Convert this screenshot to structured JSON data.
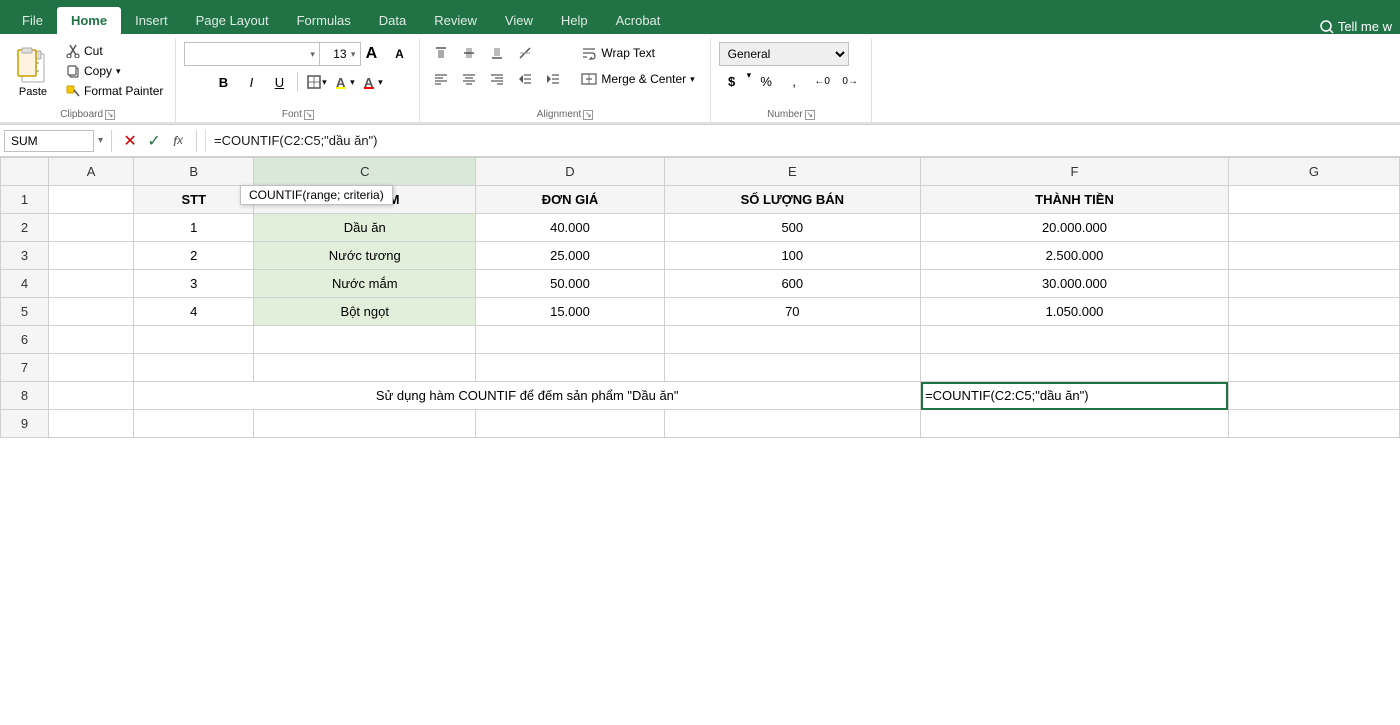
{
  "tabs": {
    "items": [
      "File",
      "Home",
      "Insert",
      "Page Layout",
      "Formulas",
      "Data",
      "Review",
      "View",
      "Help",
      "Acrobat"
    ],
    "active": "Home",
    "tell_me": "Tell me w"
  },
  "ribbon": {
    "groups": {
      "clipboard": {
        "label": "Clipboard",
        "paste_label": "Paste",
        "cut_label": "Cut",
        "copy_label": "Copy",
        "format_painter_label": "Format Painter"
      },
      "font": {
        "label": "Font",
        "font_name": "",
        "font_size": "13",
        "bold": "B",
        "italic": "I",
        "underline": "U"
      },
      "alignment": {
        "label": "Alignment",
        "wrap_text": "Wrap Text",
        "merge_center": "Merge & Center"
      },
      "number": {
        "label": "Number",
        "format": "General",
        "dollar": "$",
        "percent": "%",
        "comma": ",",
        "dec_inc": "←0",
        "dec_dec": "0→"
      }
    }
  },
  "formula_bar": {
    "name_box": "SUM",
    "formula": "=COUNTIF(C2:C5;\"dầu ăn\")",
    "tooltip": "COUNTIF(range; criteria)"
  },
  "sheet": {
    "col_headers": [
      "",
      "A",
      "B",
      "C",
      "D",
      "E",
      "F",
      "G"
    ],
    "rows": [
      {
        "num": "1",
        "a": "",
        "b": "STT",
        "c": "SẢN PHẨM",
        "d": "ĐƠN GIÁ",
        "e": "SỐ LƯỢNG BÁN",
        "f": "THÀNH TIỀN",
        "g": ""
      },
      {
        "num": "2",
        "a": "",
        "b": "1",
        "c": "Dầu ăn",
        "d": "40.000",
        "e": "500",
        "f": "20.000.000",
        "g": ""
      },
      {
        "num": "3",
        "a": "",
        "b": "2",
        "c": "Nước tương",
        "d": "25.000",
        "e": "100",
        "f": "2.500.000",
        "g": ""
      },
      {
        "num": "4",
        "a": "",
        "b": "3",
        "c": "Nước mắm",
        "d": "50.000",
        "e": "600",
        "f": "30.000.000",
        "g": ""
      },
      {
        "num": "5",
        "a": "",
        "b": "4",
        "c": "Bột ngọt",
        "d": "15.000",
        "e": "70",
        "f": "1.050.000",
        "g": ""
      },
      {
        "num": "6",
        "a": "",
        "b": "",
        "c": "",
        "d": "",
        "e": "",
        "f": "",
        "g": ""
      },
      {
        "num": "7",
        "a": "",
        "b": "",
        "c": "",
        "d": "",
        "e": "",
        "f": "",
        "g": ""
      },
      {
        "num": "8",
        "a": "",
        "b_merged": "Sử dụng hàm COUNTIF để đếm sản phẩm \"Dầu ăn\"",
        "f": "=COUNTIF(C2:C5;\"dầu ăn\")",
        "g": ""
      },
      {
        "num": "9",
        "a": "",
        "b": "",
        "c": "",
        "d": "",
        "e": "",
        "f": "",
        "g": ""
      }
    ]
  }
}
